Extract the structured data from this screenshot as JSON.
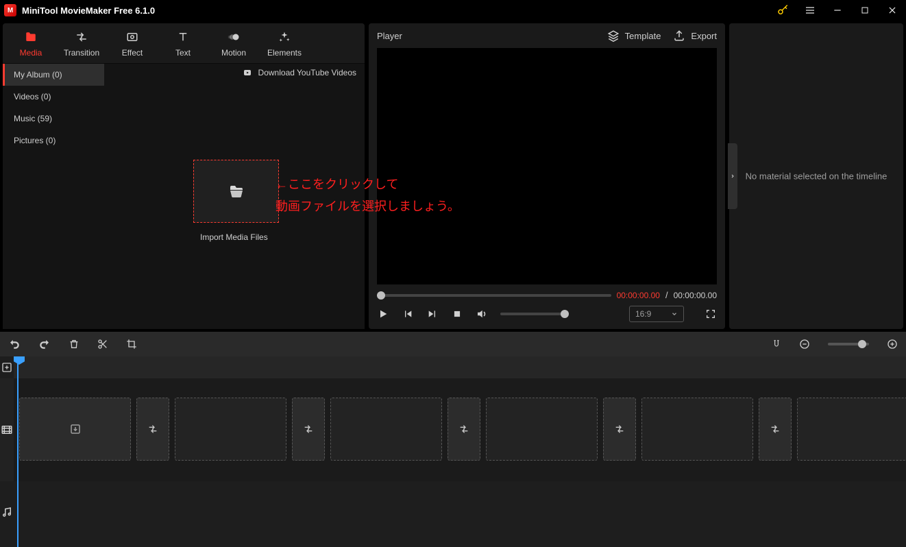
{
  "window": {
    "title": "MiniTool MovieMaker Free 6.1.0"
  },
  "tooltabs": {
    "media": "Media",
    "transition": "Transition",
    "effect": "Effect",
    "text": "Text",
    "motion": "Motion",
    "elements": "Elements"
  },
  "sidelist": {
    "myalbum": "My Album (0)",
    "videos": "Videos (0)",
    "music": "Music (59)",
    "pictures": "Pictures (0)"
  },
  "media_main": {
    "download_label": "Download YouTube Videos",
    "import_label": "Import Media Files",
    "annotation_line1": "←ここをクリックして",
    "annotation_line2": "動画ファイルを選択しましょう。"
  },
  "player": {
    "title": "Player",
    "template": "Template",
    "export": "Export",
    "time_current": "00:00:00.00",
    "time_separator": " / ",
    "time_total": "00:00:00.00",
    "aspect": "16:9"
  },
  "inspector": {
    "empty": "No material selected on the timeline"
  }
}
